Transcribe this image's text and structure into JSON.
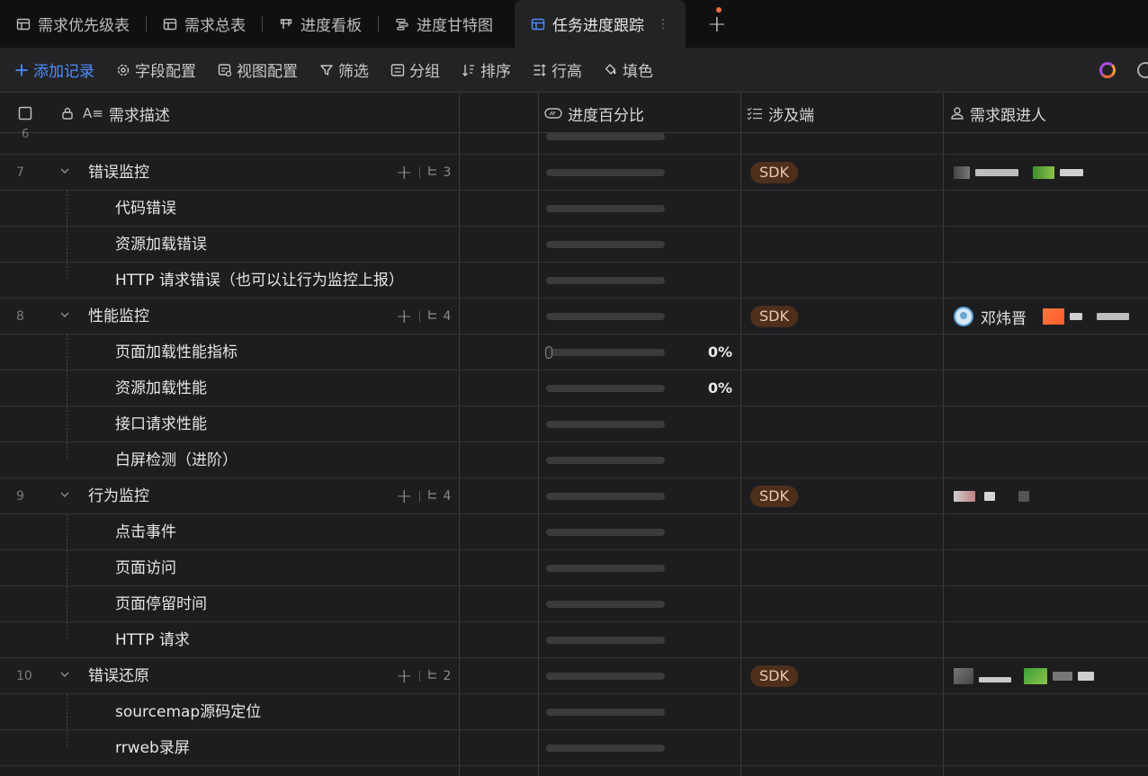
{
  "tabs": [
    {
      "label": "需求优先级表",
      "icon": "table-icon",
      "active": false
    },
    {
      "label": "需求总表",
      "icon": "table-icon",
      "active": false
    },
    {
      "label": "进度看板",
      "icon": "kanban-icon",
      "active": false
    },
    {
      "label": "进度甘特图",
      "icon": "gantt-icon",
      "active": false
    },
    {
      "label": "任务进度跟踪",
      "icon": "table-icon",
      "active": true
    }
  ],
  "tab_more": "⋮",
  "tab_add": "+",
  "toolbar": {
    "add_record": "添加记录",
    "field_config": "字段配置",
    "view_config": "视图配置",
    "filter": "筛选",
    "group": "分组",
    "sort": "排序",
    "row_height": "行高",
    "fill_color": "填色"
  },
  "columns": {
    "description": "需求描述",
    "progress": "进度百分比",
    "platform": "涉及端",
    "owner": "需求跟进人"
  },
  "cut_row_num": "6",
  "groups": [
    {
      "num": "7",
      "title": "错误监控",
      "sub_count": "3",
      "tag": "SDK",
      "children": [
        "代码错误",
        "资源加载错误",
        "HTTP 请求错误（也可以让行为监控上报）"
      ]
    },
    {
      "num": "8",
      "title": "性能监控",
      "sub_count": "4",
      "tag": "SDK",
      "owner_name": "邓炜晋",
      "children": [
        "页面加载性能指标",
        "资源加载性能",
        "接口请求性能",
        "白屏检测（进阶）"
      ],
      "child_pct": [
        "0%",
        "0%",
        "",
        ""
      ]
    },
    {
      "num": "9",
      "title": "行为监控",
      "sub_count": "4",
      "tag": "SDK",
      "children": [
        "点击事件",
        "页面访问",
        "页面停留时间",
        "HTTP 请求"
      ]
    },
    {
      "num": "10",
      "title": "错误还原",
      "sub_count": "2",
      "tag": "SDK",
      "children": [
        "sourcemap源码定位",
        "rrweb录屏"
      ]
    }
  ],
  "colors": {
    "accent": "#4d8dff",
    "tag_bg": "#4d2f1c",
    "background": "#1d1d1f"
  }
}
